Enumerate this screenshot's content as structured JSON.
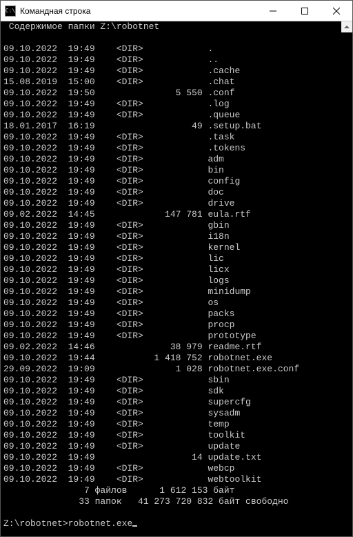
{
  "window": {
    "title": "Командная строка"
  },
  "header": "Содержимое папки Z:\\robotnet",
  "cols": {
    "dir": "<DIR>"
  },
  "rows": [
    {
      "date": "09.10.2022",
      "time": "19:49",
      "dir": true,
      "size": "",
      "name": "."
    },
    {
      "date": "09.10.2022",
      "time": "19:49",
      "dir": true,
      "size": "",
      "name": ".."
    },
    {
      "date": "09.10.2022",
      "time": "19:49",
      "dir": true,
      "size": "",
      "name": ".cache"
    },
    {
      "date": "15.08.2019",
      "time": "15:00",
      "dir": true,
      "size": "",
      "name": ".chat"
    },
    {
      "date": "09.10.2022",
      "time": "19:50",
      "dir": false,
      "size": "5 550",
      "name": ".conf"
    },
    {
      "date": "09.10.2022",
      "time": "19:49",
      "dir": true,
      "size": "",
      "name": ".log"
    },
    {
      "date": "09.10.2022",
      "time": "19:49",
      "dir": true,
      "size": "",
      "name": ".queue"
    },
    {
      "date": "18.01.2017",
      "time": "16:19",
      "dir": false,
      "size": "49",
      "name": ".setup.bat"
    },
    {
      "date": "09.10.2022",
      "time": "19:49",
      "dir": true,
      "size": "",
      "name": ".task"
    },
    {
      "date": "09.10.2022",
      "time": "19:49",
      "dir": true,
      "size": "",
      "name": ".tokens"
    },
    {
      "date": "09.10.2022",
      "time": "19:49",
      "dir": true,
      "size": "",
      "name": "adm"
    },
    {
      "date": "09.10.2022",
      "time": "19:49",
      "dir": true,
      "size": "",
      "name": "bin"
    },
    {
      "date": "09.10.2022",
      "time": "19:49",
      "dir": true,
      "size": "",
      "name": "config"
    },
    {
      "date": "09.10.2022",
      "time": "19:49",
      "dir": true,
      "size": "",
      "name": "doc"
    },
    {
      "date": "09.10.2022",
      "time": "19:49",
      "dir": true,
      "size": "",
      "name": "drive"
    },
    {
      "date": "09.02.2022",
      "time": "14:45",
      "dir": false,
      "size": "147 781",
      "name": "eula.rtf"
    },
    {
      "date": "09.10.2022",
      "time": "19:49",
      "dir": true,
      "size": "",
      "name": "gbin"
    },
    {
      "date": "09.10.2022",
      "time": "19:49",
      "dir": true,
      "size": "",
      "name": "i18n"
    },
    {
      "date": "09.10.2022",
      "time": "19:49",
      "dir": true,
      "size": "",
      "name": "kernel"
    },
    {
      "date": "09.10.2022",
      "time": "19:49",
      "dir": true,
      "size": "",
      "name": "lic"
    },
    {
      "date": "09.10.2022",
      "time": "19:49",
      "dir": true,
      "size": "",
      "name": "licx"
    },
    {
      "date": "09.10.2022",
      "time": "19:49",
      "dir": true,
      "size": "",
      "name": "logs"
    },
    {
      "date": "09.10.2022",
      "time": "19:49",
      "dir": true,
      "size": "",
      "name": "minidump"
    },
    {
      "date": "09.10.2022",
      "time": "19:49",
      "dir": true,
      "size": "",
      "name": "os"
    },
    {
      "date": "09.10.2022",
      "time": "19:49",
      "dir": true,
      "size": "",
      "name": "packs"
    },
    {
      "date": "09.10.2022",
      "time": "19:49",
      "dir": true,
      "size": "",
      "name": "procp"
    },
    {
      "date": "09.10.2022",
      "time": "19:49",
      "dir": true,
      "size": "",
      "name": "prototype"
    },
    {
      "date": "09.02.2022",
      "time": "14:46",
      "dir": false,
      "size": "38 979",
      "name": "readme.rtf"
    },
    {
      "date": "09.10.2022",
      "time": "19:44",
      "dir": false,
      "size": "1 418 752",
      "name": "robotnet.exe"
    },
    {
      "date": "29.09.2022",
      "time": "19:09",
      "dir": false,
      "size": "1 028",
      "name": "robotnet.exe.conf"
    },
    {
      "date": "09.10.2022",
      "time": "19:49",
      "dir": true,
      "size": "",
      "name": "sbin"
    },
    {
      "date": "09.10.2022",
      "time": "19:49",
      "dir": true,
      "size": "",
      "name": "sdk"
    },
    {
      "date": "09.10.2022",
      "time": "19:49",
      "dir": true,
      "size": "",
      "name": "supercfg"
    },
    {
      "date": "09.10.2022",
      "time": "19:49",
      "dir": true,
      "size": "",
      "name": "sysadm"
    },
    {
      "date": "09.10.2022",
      "time": "19:49",
      "dir": true,
      "size": "",
      "name": "temp"
    },
    {
      "date": "09.10.2022",
      "time": "19:49",
      "dir": true,
      "size": "",
      "name": "toolkit"
    },
    {
      "date": "09.10.2022",
      "time": "19:49",
      "dir": true,
      "size": "",
      "name": "update"
    },
    {
      "date": "09.10.2022",
      "time": "19:49",
      "dir": false,
      "size": "14",
      "name": "update.txt"
    },
    {
      "date": "09.10.2022",
      "time": "19:49",
      "dir": true,
      "size": "",
      "name": "webcp"
    },
    {
      "date": "09.10.2022",
      "time": "19:49",
      "dir": true,
      "size": "",
      "name": "webtoolkit"
    }
  ],
  "summary": {
    "files": "               7 файлов      1 612 153 байт",
    "dirs": "              33 папок   41 273 720 832 байт свободно"
  },
  "prompt": {
    "path": "Z:\\robotnet>",
    "cmd": "robotnet.exe"
  }
}
